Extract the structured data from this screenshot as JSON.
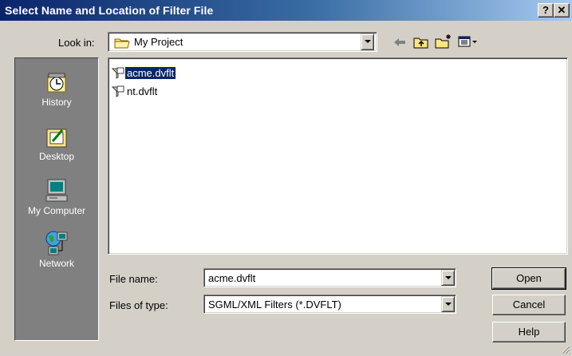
{
  "window": {
    "title": "Select Name and Location of Filter File",
    "help_glyph": "?",
    "close_glyph": "✕"
  },
  "lookin": {
    "label": "Look in:",
    "value": "My Project"
  },
  "toolbar": {
    "icons": [
      "back-arrow-icon",
      "up-folder-icon",
      "new-folder-icon",
      "view-menu-icon"
    ]
  },
  "places": [
    {
      "label": "History",
      "icon": "history-icon"
    },
    {
      "label": "Desktop",
      "icon": "desktop-icon"
    },
    {
      "label": "My Computer",
      "icon": "my-computer-icon"
    },
    {
      "label": "Network",
      "icon": "network-icon"
    }
  ],
  "files": [
    {
      "name": "acme.dvflt",
      "selected": true
    },
    {
      "name": "nt.dvflt",
      "selected": false
    }
  ],
  "form": {
    "filename_label": "File name:",
    "filename_value": "acme.dvflt",
    "filetype_label": "Files of type:",
    "filetype_value": "SGML/XML Filters (*.DVFLT)"
  },
  "buttons": {
    "open": "Open",
    "cancel": "Cancel",
    "help": "Help"
  },
  "colors": {
    "titlebar_start": "#0a246a",
    "titlebar_end": "#a6caf0",
    "selection": "#0a246a",
    "face": "#d4d0c8"
  }
}
